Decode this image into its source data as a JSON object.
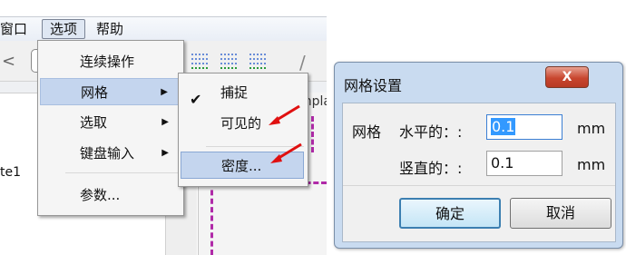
{
  "menubar": {
    "window_label": "窗口",
    "options_label": "选项",
    "help_label": "帮助"
  },
  "left_doc_label": "te1",
  "doc_tab_label": "mpla",
  "menu": {
    "items": [
      {
        "label": "连续操作",
        "has_submenu": false
      },
      {
        "label": "网格",
        "has_submenu": true
      },
      {
        "label": "选取",
        "has_submenu": true
      },
      {
        "label": "键盘输入",
        "has_submenu": true
      },
      {
        "label": "参数...",
        "has_submenu": false
      }
    ],
    "submenu_arrow": "▶"
  },
  "submenu": {
    "check_icon": "✔",
    "items": [
      {
        "label": "捕捉",
        "checked": true
      },
      {
        "label": "可见的",
        "checked": false
      },
      {
        "label": "密度...",
        "checked": false
      }
    ]
  },
  "dialog": {
    "title": "网格设置",
    "close_label": "X",
    "group_label": "网格",
    "horizontal_label": "水平的：:",
    "horizontal_value": "0.1",
    "horizontal_unit": "mm",
    "vertical_label": "竖直的：:",
    "vertical_value": "0.1",
    "vertical_unit": "mm",
    "ok_label": "确定",
    "cancel_label": "取消"
  },
  "colors": {
    "highlight": "#c4d5ee",
    "annotation_arrow": "#e01010",
    "grid_dash": "#b02aa8",
    "dialog_frame": "#c9dbf0"
  },
  "icons": [
    "left-arrow-icon",
    "grid-toolbar-icon",
    "check-icon",
    "submenu-arrow-icon",
    "close-icon",
    "red-arrow-icon"
  ]
}
